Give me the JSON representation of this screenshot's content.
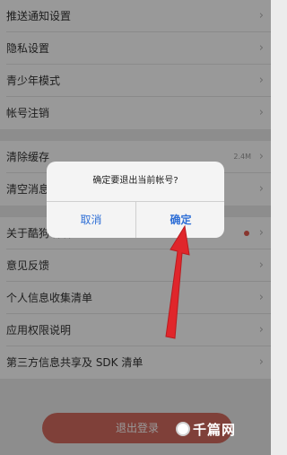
{
  "settings": {
    "items": [
      {
        "label": "推送通知设置"
      },
      {
        "label": "隐私设置"
      },
      {
        "label": "青少年模式"
      },
      {
        "label": "帐号注销"
      },
      {
        "label": "清除缓存",
        "value": "2.4M"
      },
      {
        "label": "清空消息"
      },
      {
        "label": "关于酷狗唱唱"
      },
      {
        "label": "意见反馈"
      },
      {
        "label": "个人信息收集清单"
      },
      {
        "label": "应用权限说明"
      },
      {
        "label": "第三方信息共享及 SDK 清单"
      }
    ],
    "chevron": "›"
  },
  "logout": {
    "label": "退出登录"
  },
  "dialog": {
    "message": "确定要退出当前帐号?",
    "cancel": "取消",
    "confirm": "确定"
  },
  "watermark": {
    "text": "千篇网"
  },
  "colors": {
    "accent_blue": "#2f6fd6",
    "logout_red": "#d46c60",
    "arrow_red": "#e0262b"
  }
}
